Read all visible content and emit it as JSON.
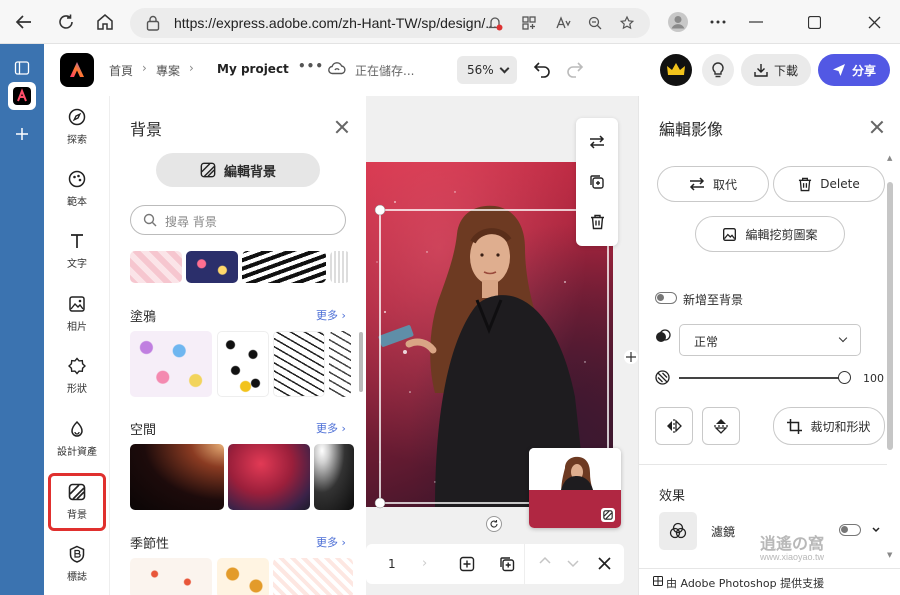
{
  "browser": {
    "url": "https://express.adobe.com/zh-Hant-TW/sp/design/..."
  },
  "header": {
    "breadcrumbs": [
      "首頁",
      "專案",
      "My project"
    ],
    "more": "•••",
    "save_status": "正在儲存...",
    "zoom": "56%",
    "download_label": "下載",
    "share_label": "分享"
  },
  "rail": [
    {
      "label": "探索",
      "icon": "compass-icon"
    },
    {
      "label": "範本",
      "icon": "templates-icon"
    },
    {
      "label": "文字",
      "icon": "text-icon"
    },
    {
      "label": "相片",
      "icon": "photo-icon"
    },
    {
      "label": "形狀",
      "icon": "shapes-icon"
    },
    {
      "label": "設計資產",
      "icon": "brand-icon"
    },
    {
      "label": "背景",
      "icon": "background-icon"
    },
    {
      "label": "標誌",
      "icon": "logo-icon"
    }
  ],
  "bgpanel": {
    "title": "背景",
    "edit_label": "編輯背景",
    "search_placeholder": "搜尋 背景",
    "sections": [
      {
        "title": "塗鴉",
        "more": "更多"
      },
      {
        "title": "空間",
        "more": "更多"
      },
      {
        "title": "季節性",
        "more": "更多"
      }
    ]
  },
  "canvas": {
    "page_number": "1"
  },
  "rightpanel": {
    "title": "編輯影像",
    "replace_label": "取代",
    "delete_label": "Delete",
    "edit_cutout_label": "編輯挖剪圖案",
    "add_to_bg_label": "新增至背景",
    "blend_mode": "正常",
    "opacity": "100",
    "crop_label": "裁切和形狀",
    "effects_title": "效果",
    "filter_label": "濾鏡",
    "footer": "由 Adobe Photoshop 提供支援"
  },
  "watermark": {
    "text": "逍遙の窩",
    "url": "www.xiaoyao.tw"
  },
  "colors": {
    "accent": "#5258e4",
    "highlight": "#e0302e",
    "edge_bar": "#3b73b0",
    "crown": "#f2c31c"
  }
}
